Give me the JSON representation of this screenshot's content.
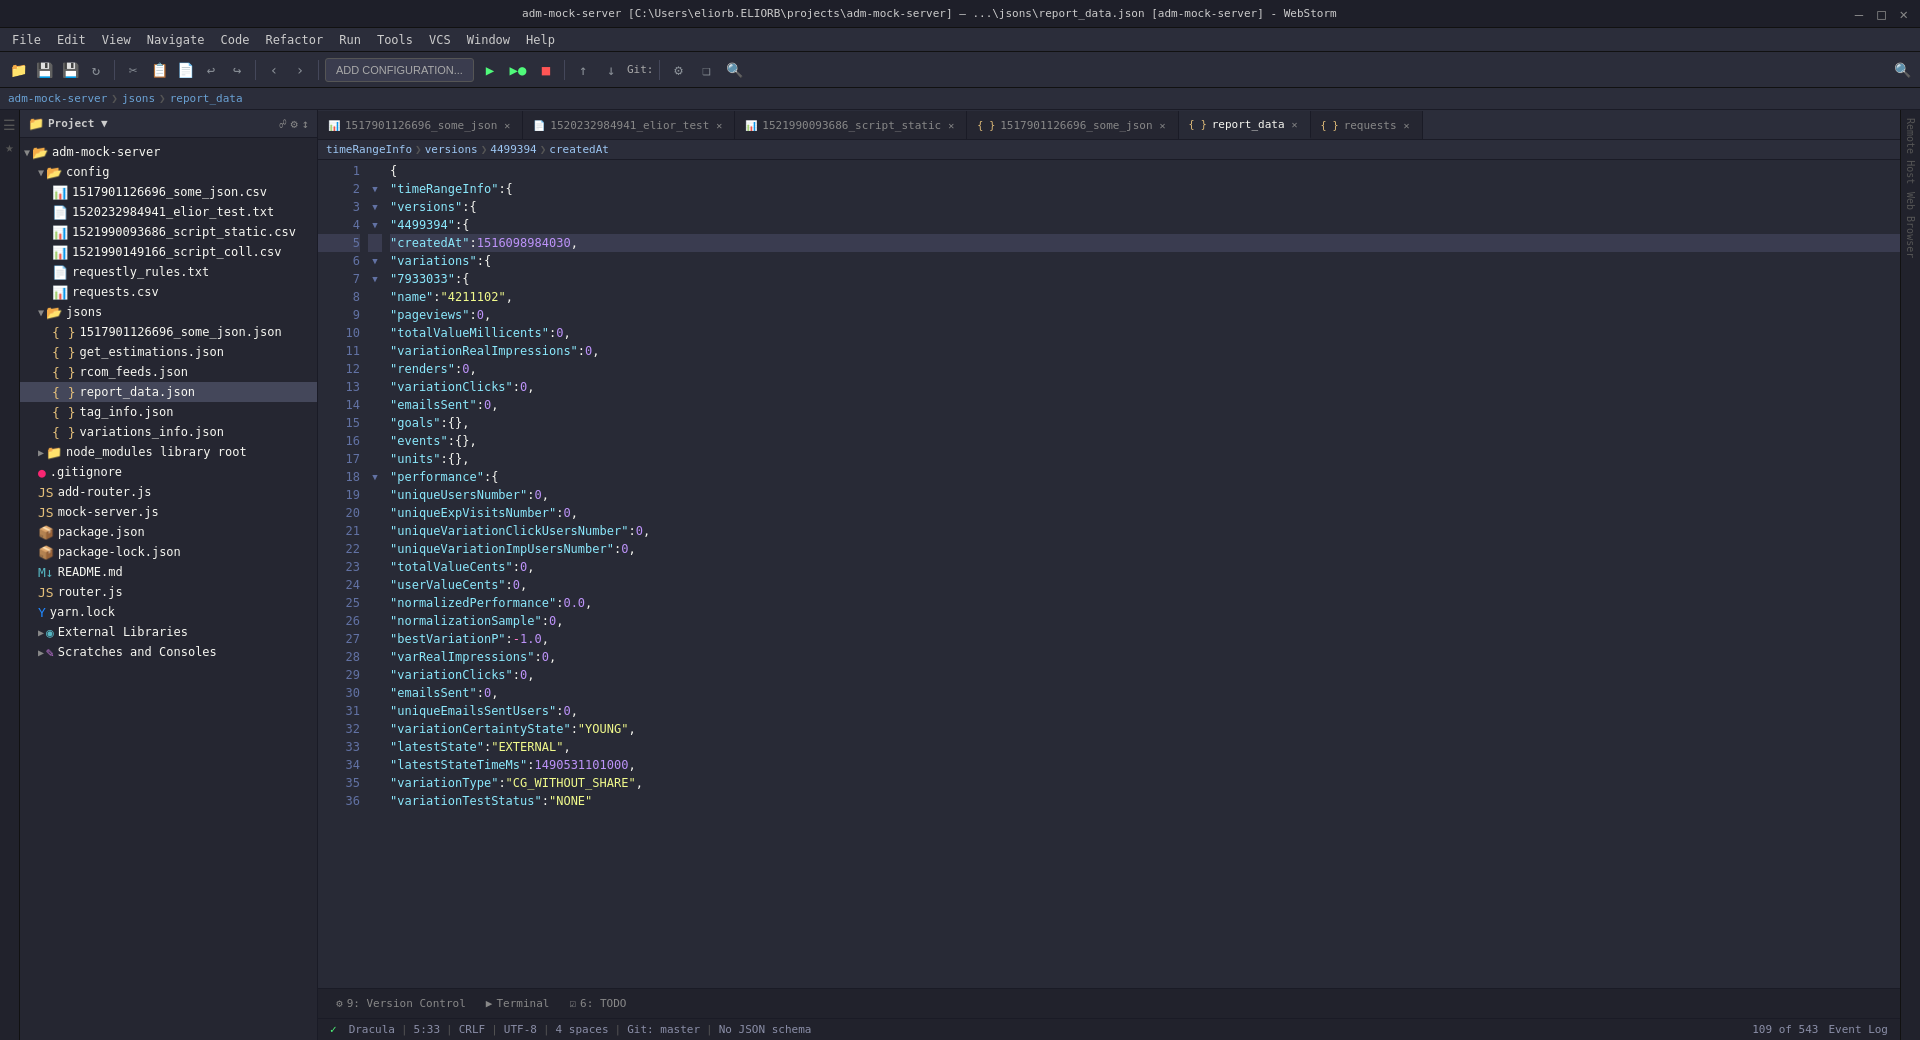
{
  "titleBar": {
    "text": "adm-mock-server [C:\\Users\\eliorb.ELIORB\\projects\\adm-mock-server] – ...\\jsons\\report_data.json [adm-mock-server] - WebStorm",
    "controls": [
      "minimize",
      "maximize",
      "close"
    ]
  },
  "menuBar": {
    "items": [
      "File",
      "Edit",
      "View",
      "Navigate",
      "Code",
      "Refactor",
      "Run",
      "Tools",
      "VCS",
      "Window",
      "Help"
    ]
  },
  "toolbar": {
    "addConfigLabel": "ADD CONFIGURATION...",
    "gitLabel": "Git:",
    "separator": "|"
  },
  "breadcrumb": {
    "items": [
      "adm-mock-server",
      "jsons",
      "report_data"
    ]
  },
  "sidebar": {
    "projectLabel": "Project",
    "tree": [
      {
        "indent": 0,
        "type": "folder-open",
        "label": "adm-mock-server",
        "expanded": true
      },
      {
        "indent": 1,
        "type": "folder-open",
        "label": "config",
        "expanded": true
      },
      {
        "indent": 2,
        "type": "csv",
        "label": "1517901126696_some_json.csv"
      },
      {
        "indent": 2,
        "type": "txt",
        "label": "1520232984941_elior_test.txt"
      },
      {
        "indent": 2,
        "type": "csv",
        "label": "1521990093686_script_static.csv"
      },
      {
        "indent": 2,
        "type": "csv",
        "label": "1521990149166_script_coll.csv"
      },
      {
        "indent": 2,
        "type": "txt",
        "label": "requestly_rules.txt"
      },
      {
        "indent": 2,
        "type": "csv",
        "label": "requests.csv"
      },
      {
        "indent": 1,
        "type": "folder-open",
        "label": "jsons",
        "expanded": true
      },
      {
        "indent": 2,
        "type": "json",
        "label": "1517901126696_some_json.json"
      },
      {
        "indent": 2,
        "type": "json",
        "label": "get_estimations.json"
      },
      {
        "indent": 2,
        "type": "json",
        "label": "rcom_feeds.json"
      },
      {
        "indent": 2,
        "type": "json",
        "label": "report_data.json",
        "selected": true
      },
      {
        "indent": 2,
        "type": "json",
        "label": "tag_info.json"
      },
      {
        "indent": 2,
        "type": "json",
        "label": "variations_info.json"
      },
      {
        "indent": 1,
        "type": "folder",
        "label": "node_modules library root"
      },
      {
        "indent": 1,
        "type": "gitignore",
        "label": ".gitignore"
      },
      {
        "indent": 1,
        "type": "js",
        "label": "add-router.js"
      },
      {
        "indent": 1,
        "type": "js",
        "label": "mock-server.js"
      },
      {
        "indent": 1,
        "type": "package",
        "label": "package.json"
      },
      {
        "indent": 1,
        "type": "package",
        "label": "package-lock.json"
      },
      {
        "indent": 1,
        "type": "md",
        "label": "README.md"
      },
      {
        "indent": 1,
        "type": "js",
        "label": "router.js"
      },
      {
        "indent": 1,
        "type": "yarn",
        "label": "yarn.lock"
      },
      {
        "indent": 1,
        "type": "ext-lib",
        "label": "External Libraries"
      },
      {
        "indent": 1,
        "type": "scratch",
        "label": "Scratches and Consoles"
      }
    ]
  },
  "tabs": [
    {
      "id": "tab1",
      "label": "1517901126696_some_json",
      "type": "csv",
      "closeable": true
    },
    {
      "id": "tab2",
      "label": "1520232984941_elior_test",
      "type": "txt",
      "closeable": true
    },
    {
      "id": "tab3",
      "label": "1521990093686_script_static",
      "type": "csv",
      "closeable": true
    },
    {
      "id": "tab4",
      "label": "1517901126696_some_json",
      "type": "json",
      "closeable": true
    },
    {
      "id": "tab5",
      "label": "report_data",
      "type": "json",
      "closeable": true,
      "active": true
    },
    {
      "id": "tab6",
      "label": "requests",
      "type": "json",
      "closeable": true
    }
  ],
  "editorBreadcrumb": {
    "items": [
      "timeRangeInfo",
      "versions",
      "4499394",
      "createdAt"
    ]
  },
  "codeLines": [
    {
      "num": 1,
      "text": "{",
      "class": ""
    },
    {
      "num": 2,
      "text": "  \"timeRangeInfo\": {",
      "class": ""
    },
    {
      "num": 3,
      "text": "    \"versions\": {",
      "class": ""
    },
    {
      "num": 4,
      "text": "      \"4499394\": {",
      "class": ""
    },
    {
      "num": 5,
      "text": "        \"createdAt\": 1516098984030,",
      "class": "highlighted"
    },
    {
      "num": 6,
      "text": "        \"variations\": {",
      "class": ""
    },
    {
      "num": 7,
      "text": "          \"7933033\": {",
      "class": ""
    },
    {
      "num": 8,
      "text": "            \"name\": \"4211102\",",
      "class": ""
    },
    {
      "num": 9,
      "text": "            \"pageviews\": 0,",
      "class": ""
    },
    {
      "num": 10,
      "text": "            \"totalValueMillicents\": 0,",
      "class": ""
    },
    {
      "num": 11,
      "text": "            \"variationRealImpressions\": 0,",
      "class": ""
    },
    {
      "num": 12,
      "text": "            \"renders\": 0,",
      "class": ""
    },
    {
      "num": 13,
      "text": "            \"variationClicks\": 0,",
      "class": ""
    },
    {
      "num": 14,
      "text": "            \"emailsSent\": 0,",
      "class": ""
    },
    {
      "num": 15,
      "text": "            \"goals\": {},",
      "class": ""
    },
    {
      "num": 16,
      "text": "            \"events\": {},",
      "class": ""
    },
    {
      "num": 17,
      "text": "            \"units\": {},",
      "class": ""
    },
    {
      "num": 18,
      "text": "            \"performance\": {",
      "class": ""
    },
    {
      "num": 19,
      "text": "              \"uniqueUsersNumber\": 0,",
      "class": ""
    },
    {
      "num": 20,
      "text": "              \"uniqueExpVisitsNumber\": 0,",
      "class": ""
    },
    {
      "num": 21,
      "text": "              \"uniqueVariationClickUsersNumber\": 0,",
      "class": ""
    },
    {
      "num": 22,
      "text": "              \"uniqueVariationImpUsersNumber\": 0,",
      "class": ""
    },
    {
      "num": 23,
      "text": "              \"totalValueCents\": 0,",
      "class": ""
    },
    {
      "num": 24,
      "text": "              \"userValueCents\": 0,",
      "class": ""
    },
    {
      "num": 25,
      "text": "              \"normalizedPerformance\": 0.0,",
      "class": ""
    },
    {
      "num": 26,
      "text": "              \"normalizationSample\": 0,",
      "class": ""
    },
    {
      "num": 27,
      "text": "              \"bestVariationP\": -1.0,",
      "class": ""
    },
    {
      "num": 28,
      "text": "              \"varRealImpressions\": 0,",
      "class": ""
    },
    {
      "num": 29,
      "text": "              \"variationClicks\": 0,",
      "class": ""
    },
    {
      "num": 30,
      "text": "              \"emailsSent\": 0,",
      "class": ""
    },
    {
      "num": 31,
      "text": "              \"uniqueEmailsSentUsers\": 0,",
      "class": ""
    },
    {
      "num": 32,
      "text": "              \"variationCertaintyState\": \"YOUNG\",",
      "class": ""
    },
    {
      "num": 33,
      "text": "              \"latestState\": \"EXTERNAL\",",
      "class": ""
    },
    {
      "num": 34,
      "text": "              \"latestStateTimeMs\": 1490531101000,",
      "class": ""
    },
    {
      "num": 35,
      "text": "              \"variationType\": \"CG_WITHOUT_SHARE\",",
      "class": ""
    },
    {
      "num": 36,
      "text": "              \"variationTestStatus\": \"NONE\"",
      "class": ""
    }
  ],
  "statusBar": {
    "theme": "Dracula",
    "line": "5",
    "col": "33",
    "lineEnding": "CRLF",
    "encoding": "UTF-8",
    "indent": "4",
    "gitBranch": "Git: master",
    "schemaLabel": "No JSON schema",
    "position": "109 of 543",
    "versionControl": "Version Control",
    "terminal": "Terminal",
    "todo": "6: TODO",
    "todoCount": "6",
    "eventLog": "Event Log",
    "noErrors": "✓"
  },
  "bottomTabs": [
    {
      "label": "Version Control",
      "icon": "9",
      "active": false
    },
    {
      "label": "Terminal",
      "active": false
    },
    {
      "label": "TODO",
      "icon": "6",
      "active": false
    }
  ]
}
